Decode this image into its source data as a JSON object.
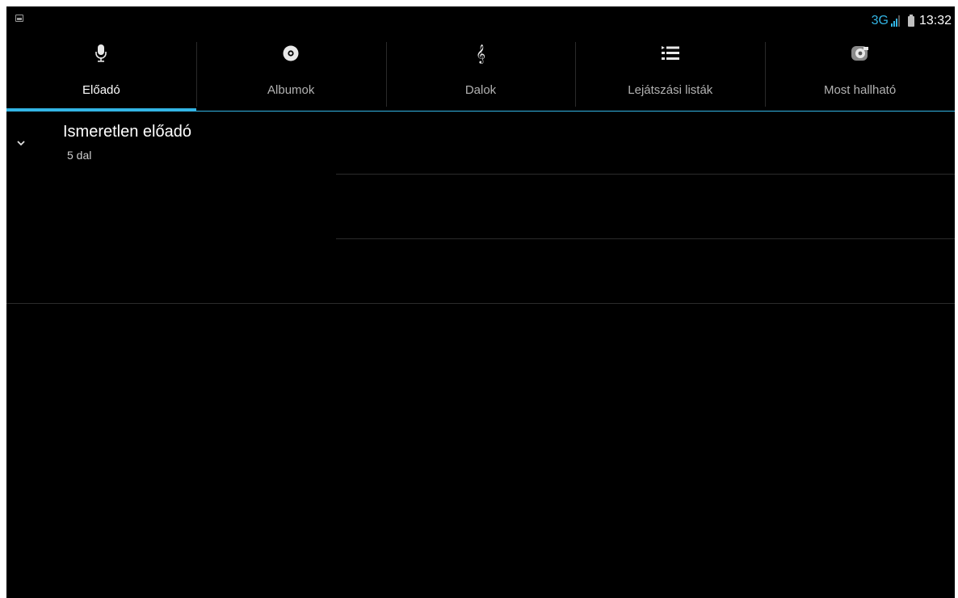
{
  "status_bar": {
    "network_type": "3G",
    "time": "13:32",
    "icons": [
      "picture-notification-icon",
      "signal-icon",
      "battery-icon"
    ],
    "accent_color": "#33b5e5"
  },
  "tabs": [
    {
      "label": "Előadó",
      "icon": "microphone-icon",
      "active": true
    },
    {
      "label": "Albumok",
      "icon": "album-disc-icon",
      "active": false
    },
    {
      "label": "Dalok",
      "icon": "treble-clef-icon",
      "active": false
    },
    {
      "label": "Lejátszási listák",
      "icon": "playlist-icon",
      "active": false
    },
    {
      "label": "Most hallható",
      "icon": "now-playing-icon",
      "active": false
    }
  ],
  "artists": [
    {
      "name": "Ismeretlen előadó",
      "song_count": "5 dal",
      "expanded": true,
      "expand_icon": "chevron-down-icon"
    }
  ]
}
